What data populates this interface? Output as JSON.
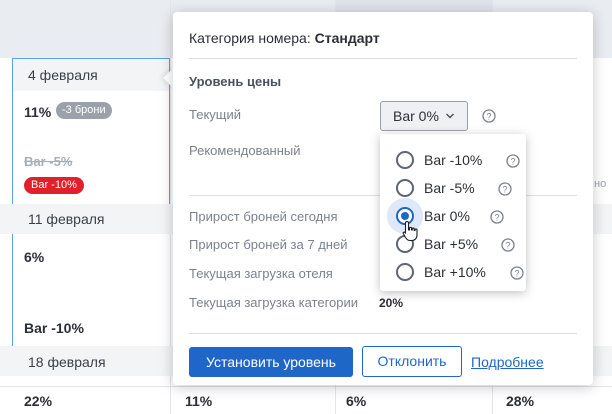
{
  "grid": {
    "dates": [
      "4 февраля",
      "11 февраля",
      "18 февраля"
    ],
    "week1": {
      "percent": "11%",
      "bookings_badge": "-3 брони",
      "old_rate": "Bar -5%",
      "new_rate_badge": "Bar -10%"
    },
    "week2": {
      "percent": "6%",
      "rate": "Bar -10%"
    },
    "week3_values": [
      "22%",
      "11%",
      "6%",
      "28%"
    ],
    "side_snippet": "но"
  },
  "popover": {
    "title_prefix": "Категория номера:",
    "title_value": "Стандарт",
    "price_level_title": "Уровень цены",
    "current_label": "Текущий",
    "current_value": "Bar 0%",
    "recommended_label": "Рекомендованный",
    "stats": [
      {
        "label": "Прирост броней сегодня",
        "value": ""
      },
      {
        "label": "Прирост броней за 7 дней",
        "value": ""
      },
      {
        "label": "Текущая загрузка отеля",
        "value": ""
      },
      {
        "label": "Текущая загрузка категории",
        "value": "20%"
      }
    ],
    "apply_button": "Установить уровень",
    "decline_button": "Отклонить",
    "more_link": "Подробнее"
  },
  "dropdown": {
    "options": [
      {
        "label": "Bar -10%",
        "checked": false
      },
      {
        "label": "Bar -5%",
        "checked": false
      },
      {
        "label": "Bar 0%",
        "checked": true
      },
      {
        "label": "Bar +5%",
        "checked": false
      },
      {
        "label": "Bar +10%",
        "checked": false
      }
    ]
  },
  "colors": {
    "accent": "#1f66c9",
    "danger": "#e0202b",
    "muted_badge": "#9aa1ab"
  }
}
